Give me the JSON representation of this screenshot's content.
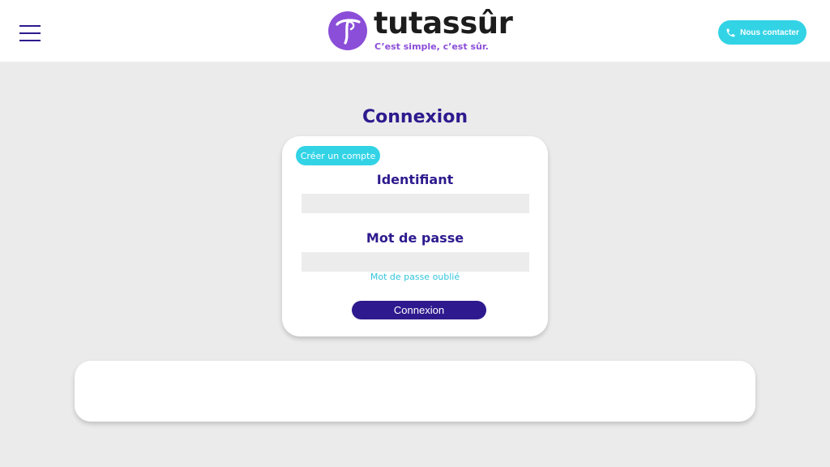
{
  "header": {
    "menu_icon": "hamburger-menu-icon",
    "brand": {
      "logo_icon": "tutassur-t-logo-icon",
      "name": "tutassûr",
      "tagline": "C’est simple, c’est sûr."
    },
    "contact": {
      "icon": "phone-icon",
      "label": "Nous contacter"
    }
  },
  "main": {
    "title": "Connexion",
    "login_card": {
      "create_account_label": "Créer un compte",
      "identifier_label": "Identifiant",
      "identifier_value": "",
      "password_label": "Mot de passe",
      "password_value": "",
      "forgot_password_label": "Mot de passe oublié",
      "submit_label": "Connexion"
    }
  },
  "colors": {
    "primary": "#2e1a8e",
    "accent": "#33d3e6",
    "brand_purple": "#8b4ed8",
    "background": "#ebebeb"
  }
}
